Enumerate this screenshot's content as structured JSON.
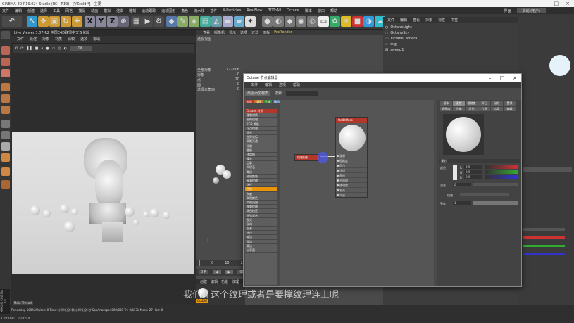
{
  "window": {
    "title": "CINEMA 4D R19.024 Studio (RC - R19) - [VZcold *] - 主要"
  },
  "menubar": [
    "文件",
    "编辑",
    "创建",
    "选择",
    "工具",
    "网格",
    "捕捉",
    "动画",
    "模拟",
    "渲染",
    "雕刻",
    "运动跟踪",
    "运动图形",
    "角色",
    "流水线",
    "插件",
    "X-Particles",
    "RealFlow",
    "3DToAll",
    "Octane",
    "脚本",
    "窗口",
    "帮助"
  ],
  "layout_label": "界面",
  "layout_value": "启动 (用户)",
  "viewport": {
    "title": "Live Viewer 3.07-R2 中国C4D联盟中文汉化版",
    "menu": [
      "文件",
      "云渲",
      "对象",
      "材质",
      "比较",
      "选项",
      "帮助"
    ],
    "mode": "DL",
    "info": "Rendering 100% Ms/sec: 0 Time: 小时:分钟:秒/小时:分钟:秒 Spp/maxspp: 800/800 Tri: 0/437k Mesh: 27 Hair: 0",
    "main_thread": "Main Thread"
  },
  "mid_panel": {
    "menu": [
      "查看",
      "摄像机",
      "显示",
      "选项",
      "过滤",
      "面板",
      "ProRender"
    ],
    "view_label": "透视视图",
    "stats": [
      [
        "全部对象",
        "377006"
      ],
      [
        "对象",
        "0"
      ],
      [
        "点",
        "20"
      ],
      [
        "面",
        "0"
      ],
      [
        "选择三角面",
        "0"
      ]
    ],
    "timeline_ticks": [
      "0",
      "10",
      "20"
    ],
    "frame_start": "0 F",
    "frame_end": "90 F",
    "material_menu": [
      "创建",
      "编辑",
      "功能",
      "纹理"
    ],
    "material_name": "OctDiff"
  },
  "object_manager": {
    "menu": [
      "文件",
      "编辑",
      "查看",
      "对象",
      "标签",
      "书签"
    ],
    "items": [
      "OctaneLight",
      "OctaneSky",
      "OctaneCamera",
      "平面",
      "sweep1"
    ]
  },
  "node_editor": {
    "title": "Octane 节点编辑器",
    "menu": [
      "文件",
      "编辑",
      "选项",
      "帮助"
    ],
    "toolbar_btn": "最近添加材质",
    "search_label": "搜索",
    "tags": [
      "材质",
      "纹理",
      "生成",
      "输出",
      "数学",
      "发光",
      "投射",
      "介质",
      "全部"
    ],
    "node_list": [
      "Octane 材质",
      "漫射材质",
      "图像纹理",
      "RGB 颜色",
      "浮点纹理",
      "混合",
      "世界坐标",
      "高斯光谱",
      "投射",
      "变换",
      "棋盘格",
      "噪波",
      "云彩",
      "大理石",
      "脊线",
      "随机颜色",
      "衰减纹理",
      "迭代",
      "色阶",
      "灰度",
      "实例颜色",
      "实例范围",
      "多重纹理",
      "颜色校正",
      "余弦混合",
      "发光",
      "反向",
      "混合",
      "钳位",
      "减法",
      "添加",
      "乘法",
      "三平面"
    ],
    "selected_index": 18,
    "node_texture_name": "纹理投射",
    "node_material_name": "OctDiffuse",
    "node_ports": [
      "漫射",
      "粗糙度",
      "凹凸",
      "法线",
      "置换",
      "不透明",
      "透明度",
      "发光",
      "介质"
    ],
    "props_tabs_row1": [
      "基本",
      "漫射",
      "粗糙度",
      "凹凸",
      "法线",
      "置换"
    ],
    "props_tabs_row2": [
      "透明度",
      "传输",
      "发光",
      "介质",
      "公用",
      "编辑"
    ],
    "props_section": "漫射",
    "color_label": "颜色",
    "rgb": [
      [
        "R",
        "0.9"
      ],
      [
        "G",
        "0.9"
      ],
      [
        "B",
        "0.9"
      ]
    ],
    "mix_label": "混合",
    "mix_value": "0",
    "texture_label": "纹理",
    "brightness_label": "亮度",
    "brightness_value": "1"
  },
  "subtitle": "我们让这个纹理或者是要撑纹理连上呢"
}
